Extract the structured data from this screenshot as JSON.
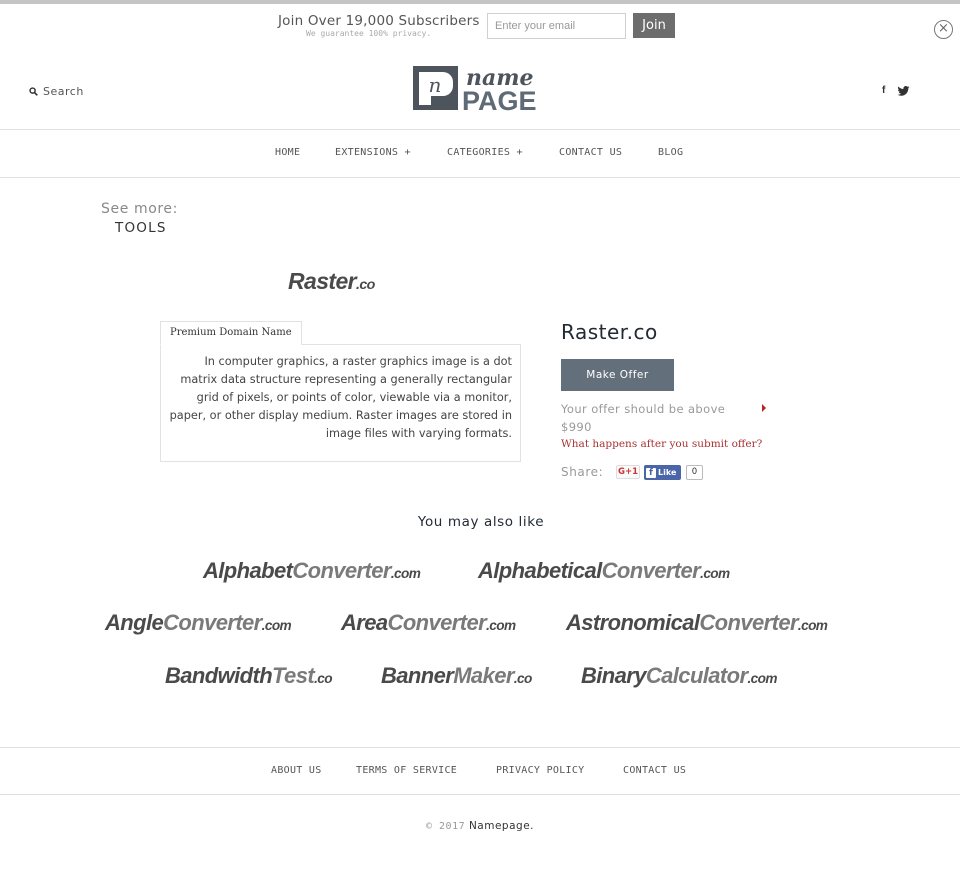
{
  "subscribe": {
    "title": "Join Over 19,000 Subscribers",
    "note": "We guarantee 100% privacy.",
    "email_placeholder": "Enter your email",
    "join_label": "Join",
    "close_symbol": "×"
  },
  "header": {
    "search_label": "Search",
    "logo": {
      "top": "name",
      "bottom": "PAGE",
      "mark": "n"
    },
    "social": {
      "facebook": "f",
      "twitter": "twitter"
    }
  },
  "nav": {
    "items": [
      {
        "label": "HOME"
      },
      {
        "label": "EXTENSIONS +"
      },
      {
        "label": "CATEGORIES +"
      },
      {
        "label": "CONTACT US"
      },
      {
        "label": "BLOG"
      }
    ]
  },
  "see_more": {
    "label": "See more:",
    "link": "TOOLS"
  },
  "domain": {
    "logo": {
      "name": "Raster",
      "tld": ".co"
    },
    "tab_label": "Premium Domain Name",
    "description": "In computer graphics, a raster graphics image is a dot matrix data structure representing a generally rectangular grid of pixels, or points of color, viewable via a monitor, paper, or other display medium. Raster images are stored in image files with varying formats.",
    "name": "Raster.co",
    "make_offer_label": "Make Offer",
    "offer_note": "Your offer should be above",
    "offer_min": "$990",
    "offer_help": "What happens after you submit offer?",
    "share_label": "Share:",
    "gplus_label": "G+1",
    "fb_like_label": "Like",
    "fb_like_count": "0"
  },
  "also_like": {
    "title": "You may also like",
    "items": [
      {
        "a": "Alphabet",
        "b": "Converter",
        "tld": ".com"
      },
      {
        "a": "Alphabetical",
        "b": "Converter",
        "tld": ".com"
      },
      {
        "a": "Angle",
        "b": "Converter",
        "tld": ".com"
      },
      {
        "a": "Area",
        "b": "Converter",
        "tld": ".com"
      },
      {
        "a": "Astronomical",
        "b": "Converter",
        "tld": ".com"
      },
      {
        "a": "Bandwidth",
        "b": "Test",
        "tld": ".co"
      },
      {
        "a": "Banner",
        "b": "Maker",
        "tld": ".co"
      },
      {
        "a": "Binary",
        "b": "Calculator",
        "tld": ".com"
      }
    ]
  },
  "footer": {
    "links": [
      {
        "label": "ABOUT US"
      },
      {
        "label": "TERMS OF SERVICE"
      },
      {
        "label": "PRIVACY POLICY"
      },
      {
        "label": "CONTACT US"
      }
    ],
    "copyright": "© 2017",
    "brand": "Namepage."
  },
  "colors": {
    "button_bg": "#636f7a",
    "join_bg": "#6d6d6d",
    "link_red": "#aa3333",
    "fb_blue": "#4a66a8"
  }
}
